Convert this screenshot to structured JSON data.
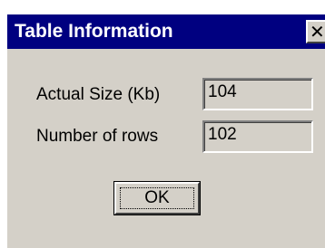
{
  "window": {
    "title": "Table Information",
    "close_glyph": "✕"
  },
  "form": {
    "actual_size_label": "Actual Size (Kb)",
    "actual_size_value": "104",
    "rows_label": "Number of rows",
    "rows_value": "102"
  },
  "buttons": {
    "ok_label": "OK"
  },
  "colors": {
    "titlebar": "#000080",
    "dialog_face": "#d4d0c8",
    "title_text": "#ffffff"
  }
}
